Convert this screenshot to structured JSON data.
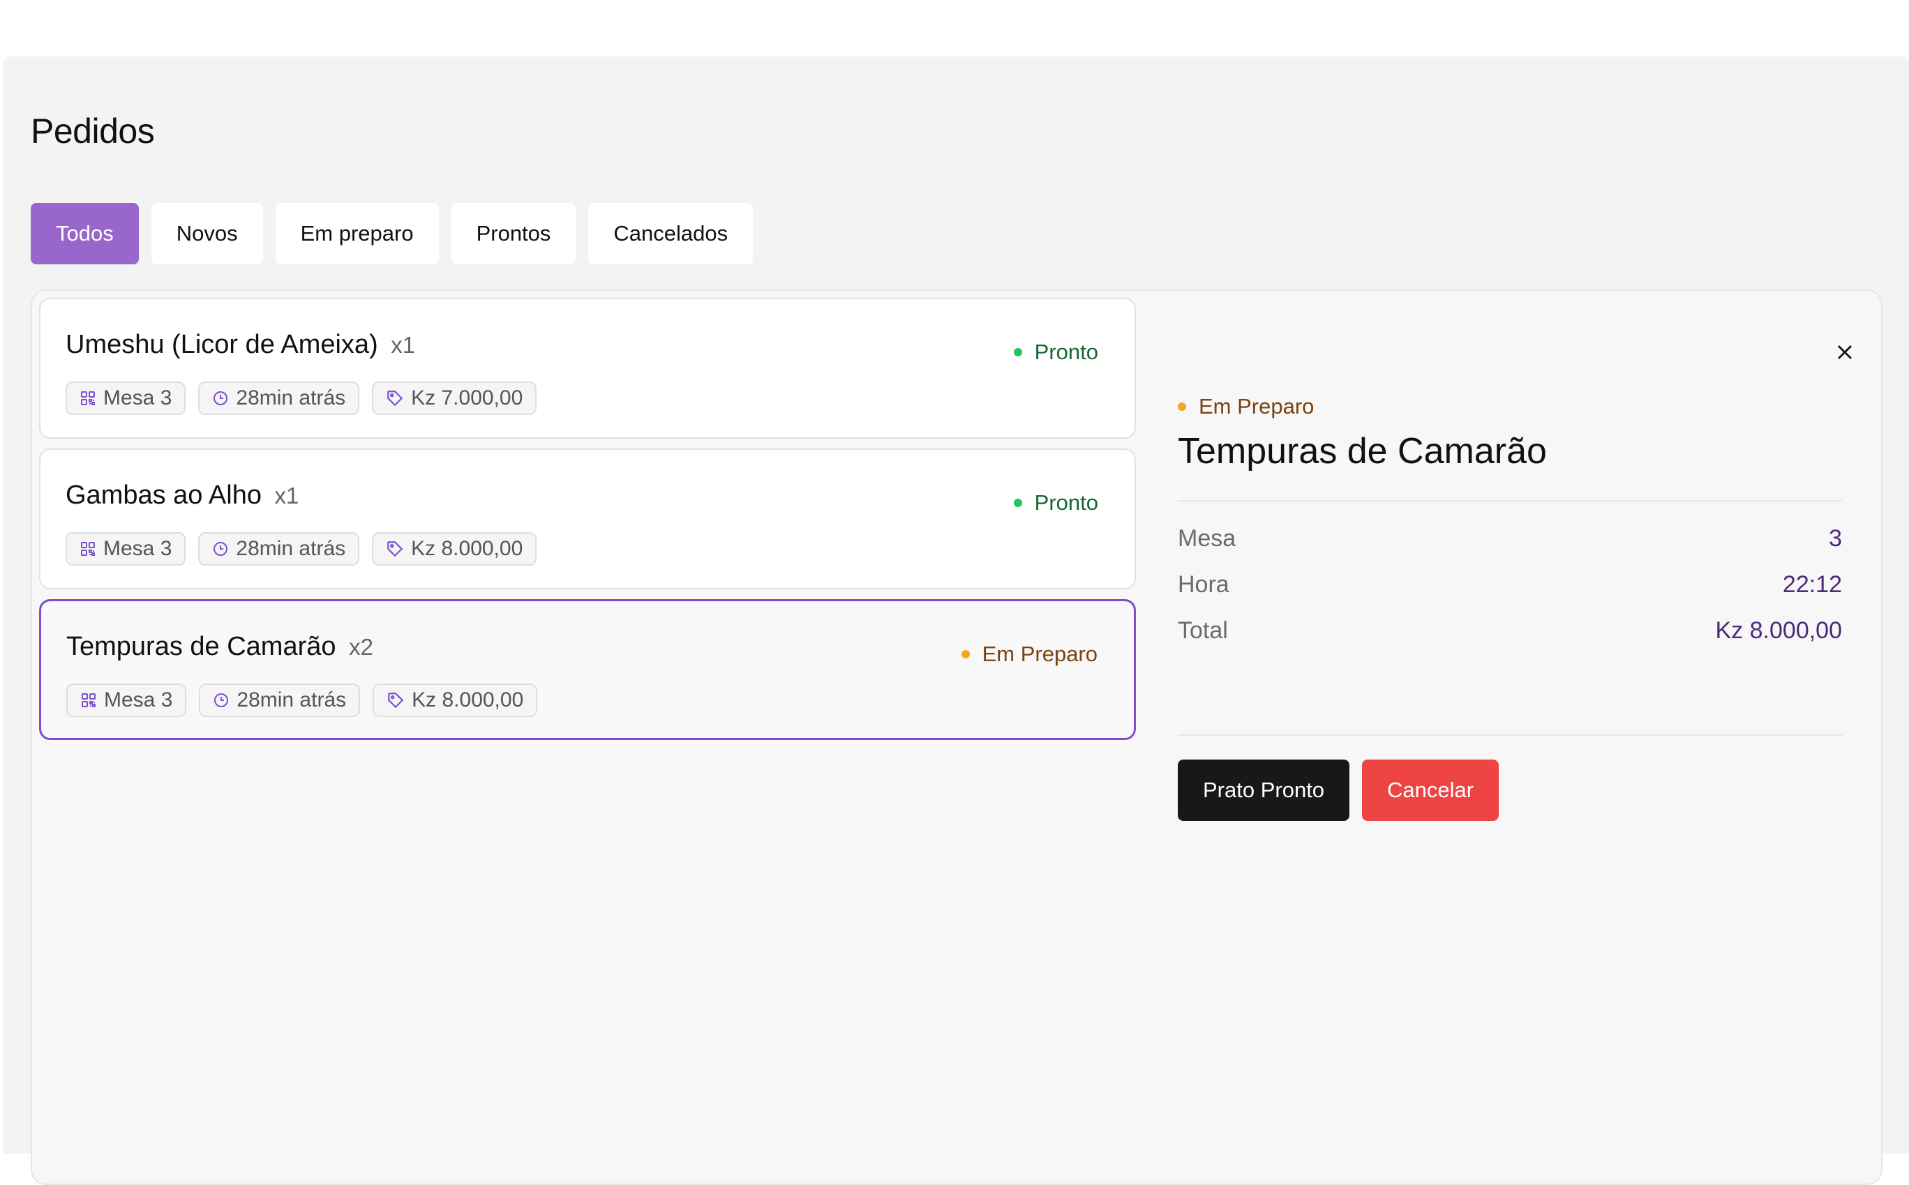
{
  "page": {
    "title": "Pedidos"
  },
  "tabs": [
    {
      "label": "Todos",
      "active": true
    },
    {
      "label": "Novos",
      "active": false
    },
    {
      "label": "Em preparo",
      "active": false
    },
    {
      "label": "Prontos",
      "active": false
    },
    {
      "label": "Cancelados",
      "active": false
    }
  ],
  "orders": [
    {
      "name": "Umeshu (Licor de Ameixa)",
      "qty": "x1",
      "status": "Pronto",
      "table": "Mesa 3",
      "time": "28min atrás",
      "price": "Kz 7.000,00"
    },
    {
      "name": "Gambas ao Alho",
      "qty": "x1",
      "status": "Pronto",
      "table": "Mesa 3",
      "time": "28min atrás",
      "price": "Kz 8.000,00"
    },
    {
      "name": "Tempuras de Camarão",
      "qty": "x2",
      "status": "Em Preparo",
      "table": "Mesa 3",
      "time": "28min atrás",
      "price": "Kz 8.000,00"
    }
  ],
  "detail": {
    "status": "Em Preparo",
    "title": "Tempuras de Camarão",
    "rows": [
      {
        "label": "Mesa",
        "value": "3"
      },
      {
        "label": "Hora",
        "value": "22:12"
      },
      {
        "label": "Total",
        "value": "Kz 8.000,00"
      }
    ],
    "ready_button": "Prato Pronto",
    "cancel_button": "Cancelar"
  },
  "colors": {
    "accent": "#9966cc",
    "selected_border": "#7c4fd0",
    "ready_dot": "#22c55e",
    "prep_dot": "#f5a623",
    "cancel": "#ef4444",
    "dark_button": "#18181b"
  },
  "icons": {
    "table": "qr-code-icon",
    "time": "clock-icon",
    "price": "tag-icon",
    "close": "close-icon"
  }
}
